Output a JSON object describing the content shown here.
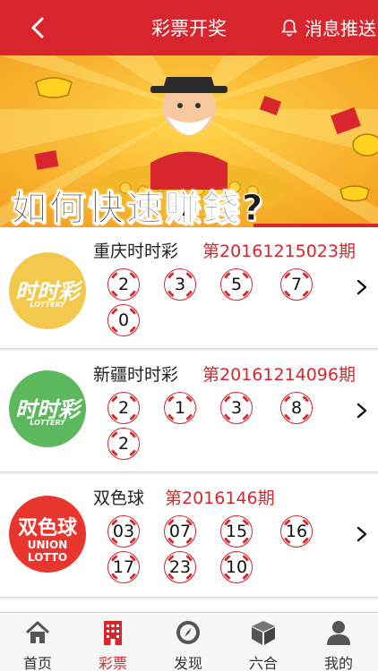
{
  "header": {
    "title": "彩票开奖",
    "push_label": "消息推送"
  },
  "banner": {
    "slogan": "如何快速賺錢?"
  },
  "lotteries": [
    {
      "name": "重庆时时彩",
      "issue": "第20161215023期",
      "logo_text": "时时彩",
      "logo_sub": "LOTTERY",
      "logo_color": "#f2c94c",
      "balls": [
        "2",
        "3",
        "5",
        "7",
        "0"
      ]
    },
    {
      "name": "新疆时时彩",
      "issue": "第20161214096期",
      "logo_text": "时时彩",
      "logo_sub": "LOTTERY",
      "logo_color": "#5cb85c",
      "balls": [
        "2",
        "1",
        "3",
        "8",
        "2"
      ]
    },
    {
      "name": "双色球",
      "issue": "第2016146期",
      "logo_text": "双色球",
      "logo_sub": "UNION LOTTO",
      "logo_color": "#e8362f",
      "balls": [
        "03",
        "07",
        "15",
        "16",
        "17",
        "23",
        "10"
      ]
    }
  ],
  "tabs": [
    {
      "label": "首页",
      "icon": "home-icon",
      "active": false
    },
    {
      "label": "彩票",
      "icon": "building-icon",
      "active": true
    },
    {
      "label": "发现",
      "icon": "compass-icon",
      "active": false
    },
    {
      "label": "六合",
      "icon": "cube-icon",
      "active": false
    },
    {
      "label": "我的",
      "icon": "user-icon",
      "active": false
    }
  ],
  "colors": {
    "brand": "#d9262e",
    "yellow_logo": "#f2c94c",
    "green_logo": "#5cb85c"
  }
}
